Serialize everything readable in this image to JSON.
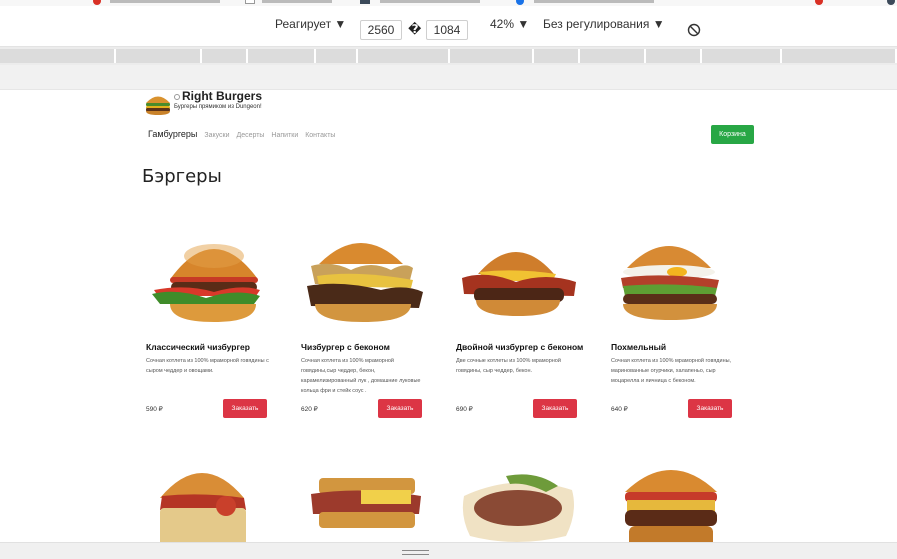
{
  "devtools": {
    "device": "Реагирует",
    "width": "2560",
    "height": "1084",
    "dimension_separator": "�",
    "zoom": "42%",
    "throttling": "Без регулирования"
  },
  "site": {
    "brand": "Right Burgers",
    "tagline": "Бургеры прямиком из Dungeon!",
    "nav": [
      "Гамбургеры",
      "Закуски",
      "Десерты",
      "Напитки",
      "Контакты"
    ],
    "cart_label": "Корзина",
    "section_title": "Бэргеры",
    "order_label": "Заказать",
    "colors": {
      "cart": "#28a745",
      "order": "#dc3545"
    }
  },
  "products": [
    {
      "name": "Классический чизбургер",
      "description": "Сочная котлета из 100% мраморной говядины с сыром чеддер и овощами.",
      "price": "590 ₽"
    },
    {
      "name": "Чизбургер с беконом",
      "description": "Сочная котлета из 100% мраморной говядины,сыр чеддер, бекон, карамелизированный лук , домашние луковые кольца фри и стейк соус .",
      "price": "620 ₽"
    },
    {
      "name": "Двойной чизбургер с беконом",
      "description": "Две сочные котлеты из 100% мраморной говядины, сыр чеддер, бекон.",
      "price": "690 ₽"
    },
    {
      "name": "Похмельный",
      "description": "Сочная котлета из 100% мраморной говядины, маринованные огурчики, халапеньо, сыр моцарелла и яичница с беконом.",
      "price": "640 ₽"
    }
  ]
}
